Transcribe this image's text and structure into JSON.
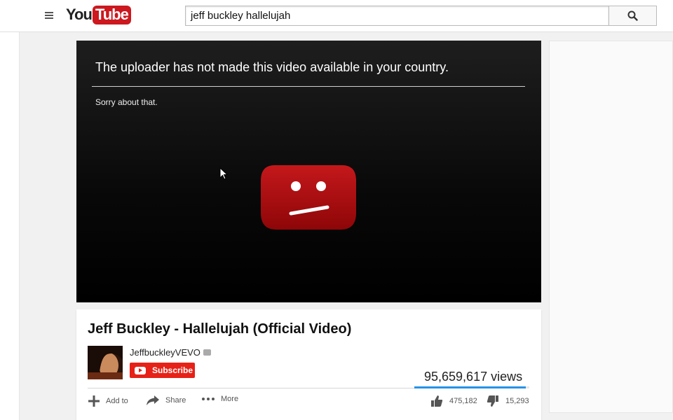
{
  "header": {
    "logo_text_you": "You",
    "logo_text_tube": "Tube",
    "search_query": "jeff buckley hallelujah"
  },
  "player": {
    "error_title": "The uploader has not made this video available in your country.",
    "error_subtitle": "Sorry about that."
  },
  "video": {
    "title": "Jeff Buckley - Hallelujah (Official Video)",
    "channel_name": "JeffbuckleyVEVO",
    "subscribe_label": "Subscribe",
    "views": "95,659,617 views",
    "like_ratio": 0.97
  },
  "actions": {
    "add_to": "Add to",
    "share": "Share",
    "more": "More",
    "likes": "475,182",
    "dislikes": "15,293"
  },
  "colors": {
    "brand_red": "#cc181e",
    "subscribe_red": "#e62117",
    "sad_icon_red": "#b0090c",
    "like_bar": "#2793e6"
  },
  "icons": [
    "menu-icon",
    "search-icon",
    "sad-face-icon",
    "cursor-icon",
    "add-icon",
    "share-icon",
    "more-icon",
    "thumbs-up-icon",
    "thumbs-down-icon",
    "verified-icon",
    "youtube-mini-icon"
  ]
}
